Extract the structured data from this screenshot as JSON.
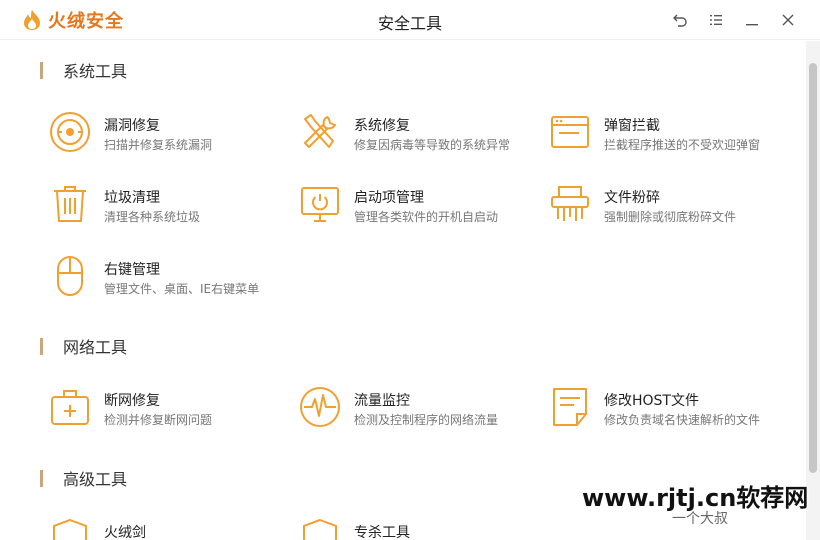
{
  "app": {
    "brand": "火绒安全",
    "window_title": "安全工具",
    "accent_color": "#f0a030"
  },
  "window_controls": [
    {
      "name": "back-icon"
    },
    {
      "name": "menu-icon"
    },
    {
      "name": "minimize-icon"
    },
    {
      "name": "close-icon"
    }
  ],
  "sections": [
    {
      "title": "系统工具",
      "tools": [
        {
          "name": "漏洞修复",
          "desc": "扫描并修复系统漏洞",
          "icon": "shield-bug-icon"
        },
        {
          "name": "系统修复",
          "desc": "修复因病毒等导致的系统异常",
          "icon": "wrench-screwdriver-icon"
        },
        {
          "name": "弹窗拦截",
          "desc": "拦截程序推送的不受欢迎弹窗",
          "icon": "popup-window-icon"
        },
        {
          "name": "垃圾清理",
          "desc": "清理各种系统垃圾",
          "icon": "trash-icon"
        },
        {
          "name": "启动项管理",
          "desc": "管理各类软件的开机自启动",
          "icon": "monitor-power-icon"
        },
        {
          "name": "文件粉碎",
          "desc": "强制删除或彻底粉碎文件",
          "icon": "shredder-icon"
        },
        {
          "name": "右键管理",
          "desc": "管理文件、桌面、IE右键菜单",
          "icon": "mouse-icon"
        }
      ]
    },
    {
      "title": "网络工具",
      "tools": [
        {
          "name": "断网修复",
          "desc": "检测并修复断网问题",
          "icon": "first-aid-kit-icon"
        },
        {
          "name": "流量监控",
          "desc": "检测及控制程序的网络流量",
          "icon": "traffic-wave-icon"
        },
        {
          "name": "修改HOST文件",
          "desc": "修改负责域名快速解析的文件",
          "icon": "host-file-icon"
        }
      ]
    },
    {
      "title": "高级工具",
      "tools": [
        {
          "name": "火绒剑",
          "desc": "",
          "icon": "shield-icon"
        },
        {
          "name": "专杀工具",
          "desc": "",
          "icon": "shield-icon"
        }
      ]
    }
  ],
  "watermark": {
    "text": "www.rjtj.cn软荐网",
    "sub": "一个大叔"
  }
}
